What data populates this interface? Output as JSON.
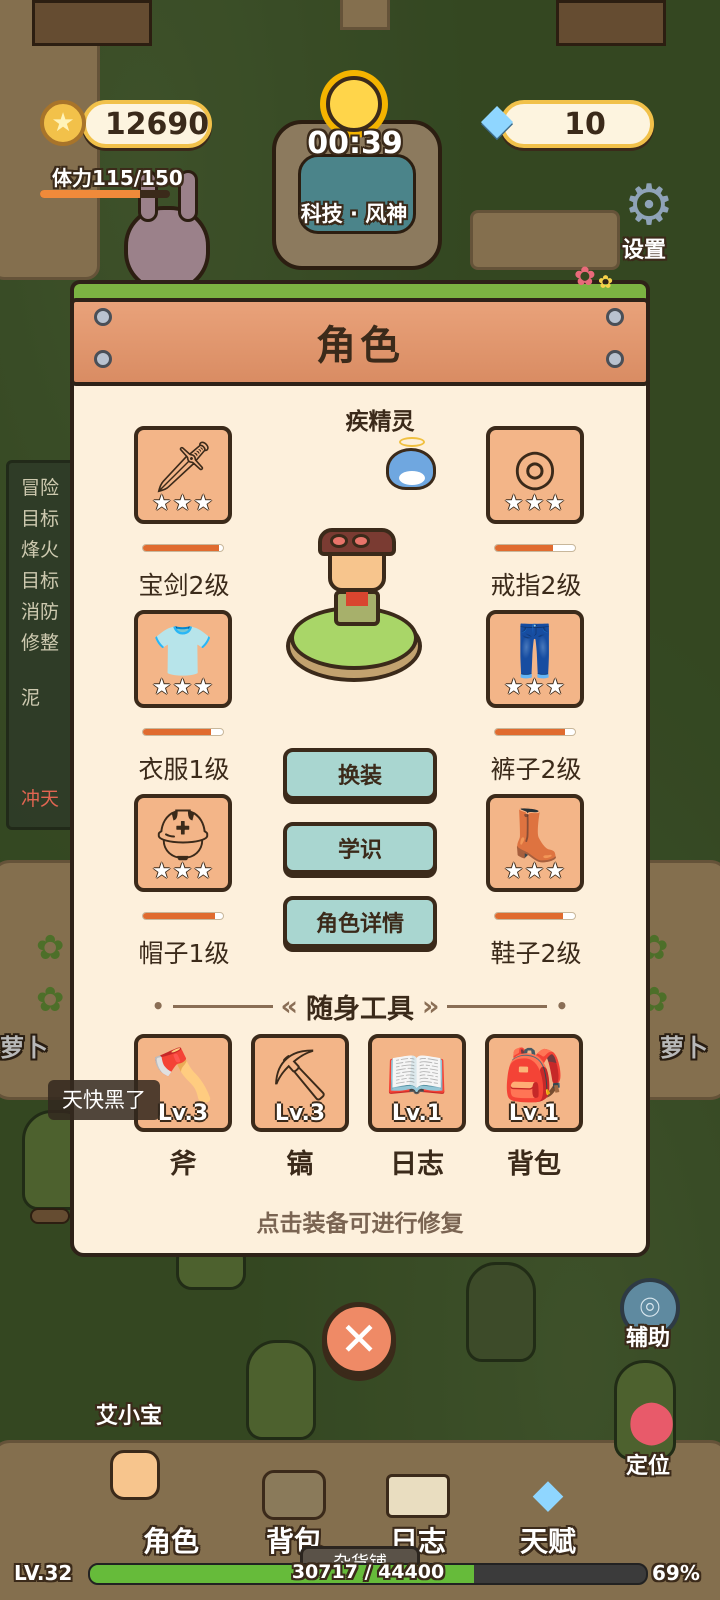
{
  "hud": {
    "coins": "12690",
    "gems": "10",
    "stamina_label": "体力115/150",
    "stamina_fraction": 0.77,
    "timer": "00:39",
    "landmark": "科技 · 风神",
    "settings_label": "设置"
  },
  "side_panel": {
    "title": "冒险",
    "lines": [
      "目标",
      "烽火",
      "目标",
      "消防",
      "修整"
    ],
    "item_label": "泥",
    "alert_label": "冲天"
  },
  "panel": {
    "title": "角色",
    "pet_name": "疾精灵",
    "equipment": {
      "sword": {
        "label": "宝剑2级",
        "icon": "sword-icon",
        "stars": "★★★",
        "durability": 0.95
      },
      "ring": {
        "label": "戒指2级",
        "icon": "ring-icon",
        "stars": "★★★",
        "durability": 0.72
      },
      "clothes": {
        "label": "衣服1级",
        "icon": "shirt-icon",
        "stars": "★★★",
        "durability": 0.85
      },
      "pants": {
        "label": "裤子2级",
        "icon": "pants-icon",
        "stars": "★★★",
        "durability": 0.88
      },
      "hat": {
        "label": "帽子1级",
        "icon": "helmet-icon",
        "stars": "★★★",
        "durability": 0.9
      },
      "shoes": {
        "label": "鞋子2级",
        "icon": "boot-icon",
        "stars": "★★★",
        "durability": 0.85
      }
    },
    "buttons": {
      "change": "换装",
      "learn": "学识",
      "details": "角色详情"
    },
    "tools_title": "随身工具",
    "tools": [
      {
        "name": "斧",
        "level": "Lv.3",
        "icon": "axe-icon"
      },
      {
        "name": "镐",
        "level": "Lv.3",
        "icon": "pickaxe-icon"
      },
      {
        "name": "日志",
        "level": "Lv.1",
        "icon": "journal-icon"
      },
      {
        "name": "背包",
        "level": "Lv.1",
        "icon": "backpack-icon"
      }
    ],
    "hint": "点击装备可进行修复"
  },
  "world": {
    "toast": "天快黑了",
    "carrot_left": "萝卜",
    "carrot_right": "萝卜",
    "npc_name": "艾小宝",
    "assist_label": "辅助",
    "locate_label": "定位",
    "shop_label": "杂货铺"
  },
  "bottom_nav": {
    "character": "角色",
    "backpack": "背包",
    "journal": "日志",
    "talent": "天赋"
  },
  "xp": {
    "level": "LV.32",
    "text": "30717 / 44400",
    "percent": "69%",
    "fraction": 0.69
  },
  "colors": {
    "accent": "#e06b2f",
    "panel_bg": "#fdf0dc",
    "banner": "#d98c63",
    "button": "#a9d6d0"
  }
}
